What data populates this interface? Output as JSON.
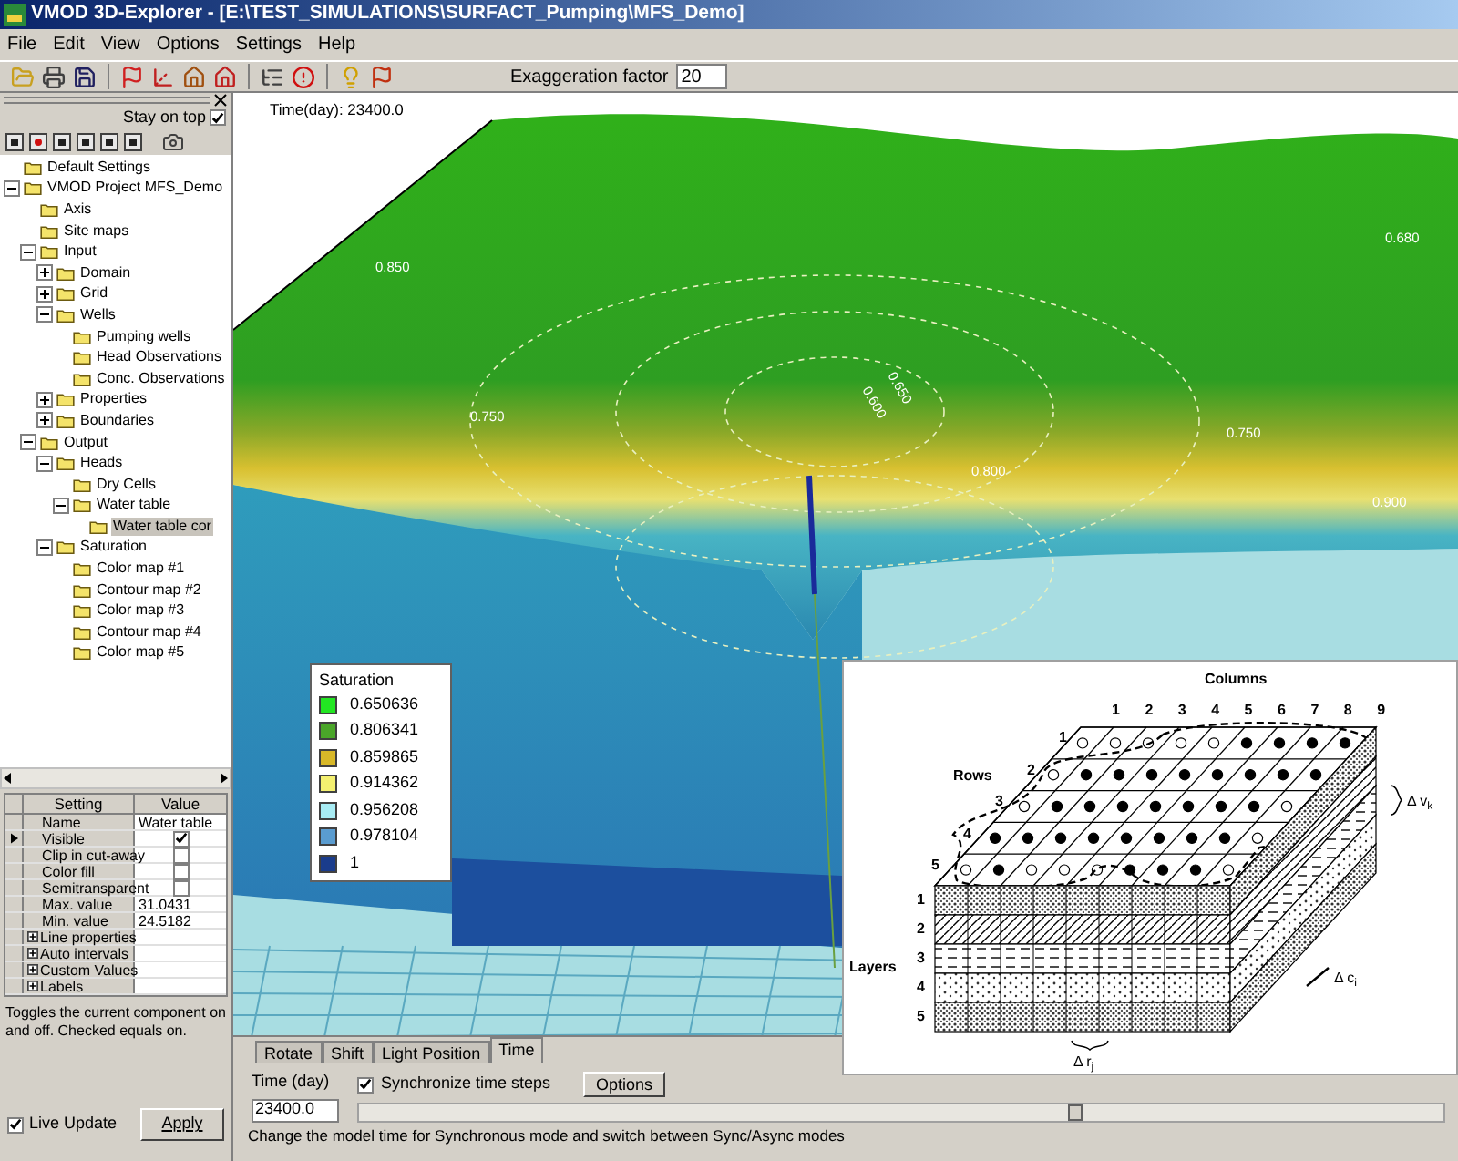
{
  "window": {
    "title": "VMOD 3D-Explorer - [E:\\TEST_SIMULATIONS\\SURFACT_Pumping\\MFS_Demo]"
  },
  "menu": [
    "File",
    "Edit",
    "View",
    "Options",
    "Settings",
    "Help"
  ],
  "toolbar": {
    "exaggeration_label": "Exaggeration factor",
    "exaggeration_value": "20"
  },
  "left_panel": {
    "stay_on_top": {
      "label": "Stay on top",
      "checked": true
    },
    "tree": [
      {
        "label": "Default Settings",
        "kind": "leaf",
        "selected": false
      },
      {
        "label": "VMOD Project MFS_Demo",
        "kind": "node",
        "expanded": true,
        "selected": false,
        "children": [
          {
            "label": "Axis",
            "kind": "leaf",
            "selected": false
          },
          {
            "label": "Site maps",
            "kind": "leaf",
            "selected": false
          },
          {
            "label": "Input",
            "kind": "node",
            "expanded": true,
            "selected": false,
            "children": [
              {
                "label": "Domain",
                "kind": "node",
                "expanded": false,
                "selected": false
              },
              {
                "label": "Grid",
                "kind": "node",
                "expanded": false,
                "selected": false
              },
              {
                "label": "Wells",
                "kind": "node",
                "expanded": true,
                "selected": false,
                "children": [
                  {
                    "label": "Pumping wells",
                    "kind": "leaf",
                    "selected": false
                  },
                  {
                    "label": "Head Observations",
                    "kind": "leaf",
                    "selected": false
                  },
                  {
                    "label": "Conc. Observations",
                    "kind": "leaf",
                    "selected": false
                  }
                ]
              },
              {
                "label": "Properties",
                "kind": "node",
                "expanded": false,
                "selected": false
              },
              {
                "label": "Boundaries",
                "kind": "node",
                "expanded": false,
                "selected": false
              }
            ]
          },
          {
            "label": "Output",
            "kind": "node",
            "expanded": true,
            "selected": false,
            "children": [
              {
                "label": "Heads",
                "kind": "node",
                "expanded": true,
                "selected": false,
                "children": [
                  {
                    "label": "Dry Cells",
                    "kind": "leaf",
                    "selected": false
                  },
                  {
                    "label": "Water table",
                    "kind": "node",
                    "expanded": true,
                    "selected": false,
                    "children": [
                      {
                        "label": "Water table cor",
                        "kind": "leaf",
                        "selected": true
                      }
                    ]
                  }
                ]
              },
              {
                "label": "Saturation",
                "kind": "node",
                "expanded": true,
                "selected": false,
                "children": [
                  {
                    "label": "Color map #1",
                    "kind": "leaf",
                    "selected": false
                  },
                  {
                    "label": "Contour map #2",
                    "kind": "leaf",
                    "selected": false
                  },
                  {
                    "label": "Color map #3",
                    "kind": "leaf",
                    "selected": false
                  },
                  {
                    "label": "Contour map #4",
                    "kind": "leaf",
                    "selected": false
                  },
                  {
                    "label": "Color map #5",
                    "kind": "leaf",
                    "selected": false
                  }
                ]
              }
            ]
          }
        ]
      }
    ],
    "properties": {
      "columns": [
        "Setting",
        "Value"
      ],
      "rows": [
        {
          "setting": "Name",
          "kind": "text",
          "value": "Water table",
          "selected": false
        },
        {
          "setting": "Visible",
          "kind": "check",
          "checked": true,
          "selected": true
        },
        {
          "setting": "Clip in cut-away",
          "kind": "check",
          "checked": false,
          "selected": false
        },
        {
          "setting": "Color fill",
          "kind": "check",
          "checked": false,
          "selected": false
        },
        {
          "setting": "Semitransparent",
          "kind": "check",
          "checked": false,
          "selected": false
        },
        {
          "setting": "Max. value",
          "kind": "text",
          "value": "31.0431",
          "selected": false
        },
        {
          "setting": "Min. value",
          "kind": "text",
          "value": "24.5182",
          "selected": false
        },
        {
          "setting": "Line properties",
          "kind": "group",
          "selected": false
        },
        {
          "setting": "Auto intervals",
          "kind": "group",
          "selected": false
        },
        {
          "setting": "Custom Values",
          "kind": "group",
          "selected": false
        },
        {
          "setting": "Labels",
          "kind": "group",
          "selected": false
        }
      ]
    },
    "help_text": "Toggles the current component on and off. Checked equals on.",
    "live_update": {
      "label": "Live Update",
      "checked": true
    },
    "apply_button": "Apply"
  },
  "viewport": {
    "time_label": "Time(day): 23400.0",
    "contour_labels": [
      "0.850",
      "0.680",
      "0.750",
      "0.650",
      "0.600",
      "0.800",
      "0.750",
      "0.900"
    ],
    "legend": {
      "title": "Saturation",
      "items": [
        {
          "label": "0.650636",
          "color": "#22e622"
        },
        {
          "label": "0.806341",
          "color": "#4aa629"
        },
        {
          "label": "0.859865",
          "color": "#d8b828"
        },
        {
          "label": "0.914362",
          "color": "#f4f070"
        },
        {
          "label": "0.956208",
          "color": "#a8ecf4"
        },
        {
          "label": "0.978104",
          "color": "#5a9cd0"
        },
        {
          "label": "1",
          "color": "#1a3c8c"
        }
      ]
    }
  },
  "inset": {
    "columns_label": "Columns",
    "column_numbers": [
      "1",
      "2",
      "3",
      "4",
      "5",
      "6",
      "7",
      "8",
      "9"
    ],
    "rows_label": "Rows",
    "row_numbers": [
      "1",
      "2",
      "3",
      "4",
      "5"
    ],
    "layers_label": "Layers",
    "layer_numbers": [
      "1",
      "2",
      "3",
      "4",
      "5"
    ],
    "annotations": [
      "Δ v$_{k}$",
      "Δ c$_{i}$",
      "Δ r$_{j}$"
    ]
  },
  "bottom_panel": {
    "tabs": [
      {
        "label": "Rotate",
        "selected": false
      },
      {
        "label": "Shift",
        "selected": false
      },
      {
        "label": "Light Position",
        "selected": false
      },
      {
        "label": "Time",
        "selected": true
      }
    ],
    "time_label": "Time (day)",
    "time_value": "23400.0",
    "sync": {
      "label": "Synchronize time steps",
      "checked": true
    },
    "options_button": "Options",
    "slider": {
      "level": 0.66
    },
    "status": "Change the model time for Synchronous mode and switch between Sync/Async modes"
  }
}
